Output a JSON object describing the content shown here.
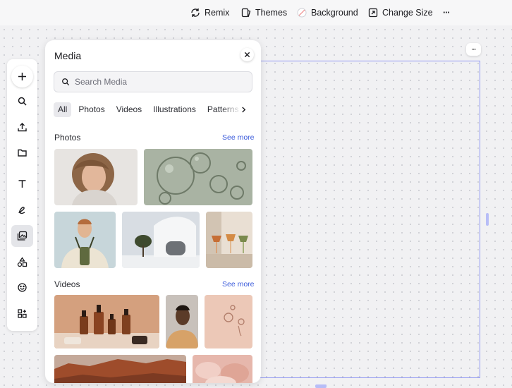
{
  "toolbar": {
    "remix": "Remix",
    "themes": "Themes",
    "background": "Background",
    "change_size": "Change Size",
    "more": "···"
  },
  "rail": {
    "items": [
      "add-icon",
      "search-icon",
      "upload-icon",
      "folder-icon",
      "text-icon",
      "draw-icon",
      "media-icon",
      "shapes-icon",
      "emoji-icon",
      "apps-icon"
    ],
    "active": "media-icon"
  },
  "media_panel": {
    "title": "Media",
    "search_placeholder": "Search Media",
    "tabs": [
      "All",
      "Photos",
      "Videos",
      "Illustrations",
      "Patterns"
    ],
    "active_tab": "All",
    "photos": {
      "title": "Photos",
      "see_more": "See more"
    },
    "videos": {
      "title": "Videos",
      "see_more": "See more"
    }
  },
  "canvas": {
    "more": "···"
  },
  "colors": {
    "accent": "#3b5bdb",
    "selection": "#8f97f2"
  }
}
